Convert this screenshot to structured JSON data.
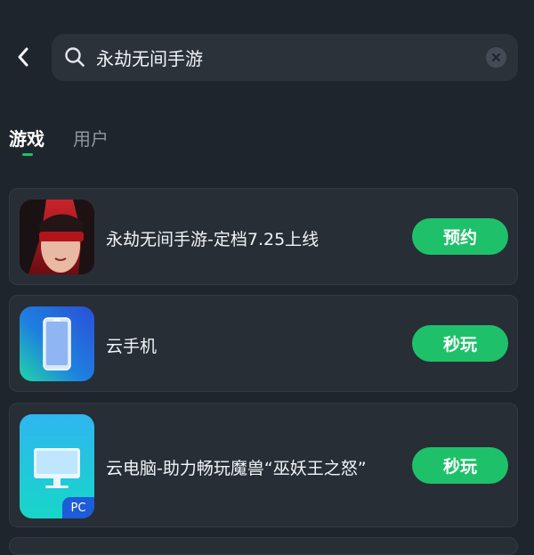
{
  "search": {
    "value": "永劫无间手游",
    "placeholder": ""
  },
  "tabs": [
    {
      "label": "游戏",
      "active": true
    },
    {
      "label": "用户",
      "active": false
    }
  ],
  "results": [
    {
      "title": "永劫无间手游-定档7.25上线",
      "action": "预约",
      "icon": "game-character-icon"
    },
    {
      "title": "云手机",
      "action": "秒玩",
      "icon": "phone-icon"
    },
    {
      "title": "云电脑-助力畅玩魔兽“巫妖王之怒”",
      "action": "秒玩",
      "icon": "pc-monitor-icon",
      "badge": "PC"
    }
  ],
  "colors": {
    "background": "#1f252c",
    "card": "#272e36",
    "accent": "#1ec16a"
  }
}
